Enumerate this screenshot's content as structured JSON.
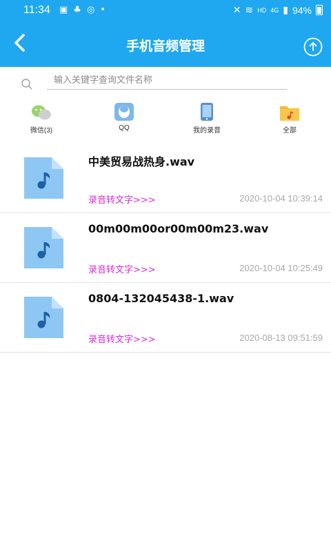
{
  "statusbar": {
    "time": "11:34",
    "battery_percent": "94%",
    "hd": "HD",
    "network": "4G"
  },
  "header": {
    "title": "手机音频管理"
  },
  "search": {
    "placeholder": "输入关键字查询文件名称"
  },
  "categories": [
    {
      "label": "微信(3)",
      "icon": "wechat-icon"
    },
    {
      "label": "QQ",
      "icon": "qq-icon"
    },
    {
      "label": "我的录音",
      "icon": "phone-icon"
    },
    {
      "label": "全部",
      "icon": "folder-icon"
    }
  ],
  "files": [
    {
      "name": "中美贸易战热身.wav",
      "action": "录音转文字>>>",
      "time": "2020-10-04 10:39:14"
    },
    {
      "name": "00m00m00or00m00m23.wav",
      "action": "录音转文字>>>",
      "time": "2020-10-04 10:25:49"
    },
    {
      "name": "0804-132045438-1.wav",
      "action": "录音转文字>>>",
      "time": "2020-08-13 09:51:59"
    }
  ],
  "colors": {
    "primary": "#1fa8f0",
    "action": "#d12fd1",
    "file_icon": "#8fc7f4",
    "music_note": "#1f5fa6"
  }
}
